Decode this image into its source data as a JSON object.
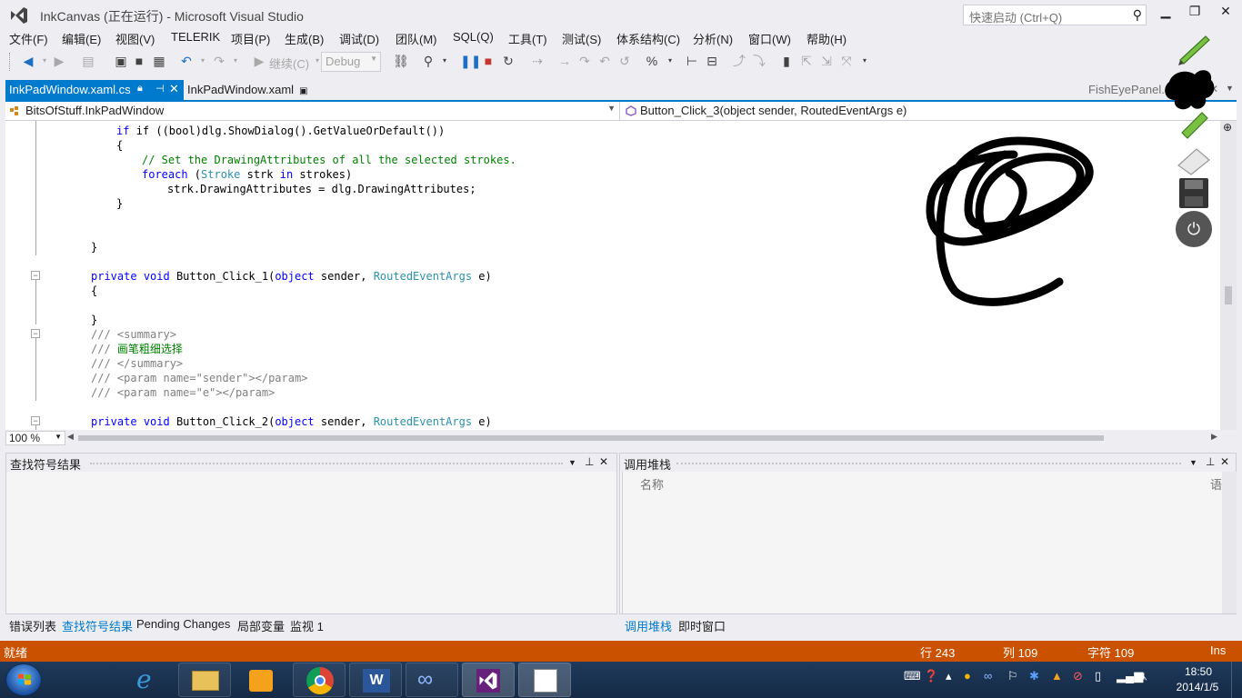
{
  "window": {
    "title": "InkCanvas (正在运行) - Microsoft Visual Studio",
    "quick_launch_placeholder": "快速启动 (Ctrl+Q)",
    "minimize": "▁",
    "restore": "❐",
    "close": "✕"
  },
  "menu": [
    "文件(F)",
    "编辑(E)",
    "视图(V)",
    "TELERIK",
    "项目(P)",
    "生成(B)",
    "调试(D)",
    "团队(M)",
    "SQL(Q)",
    "工具(T)",
    "测试(S)",
    "体系结构(C)",
    "分析(N)",
    "窗口(W)",
    "帮助(H)"
  ],
  "toolbar": {
    "continue_label": "继续(C)",
    "config_label": "Debug"
  },
  "tabs": {
    "active": "InkPadWindow.xaml.cs",
    "second": "InkPadWindow.xaml",
    "right": "FishEyePanel.cs"
  },
  "navbar": {
    "class_name": "BitsOfStuff.InkPadWindow",
    "member_name": "Button_Click_3(object sender, RoutedEventArgs e)"
  },
  "code": {
    "l1": "if ((bool)dlg.ShowDialog().GetValueOrDefault())",
    "l2": "{",
    "l3": "// Set the DrawingAttributes of all the selected strokes.",
    "l4a": "foreach",
    "l4b": " (",
    "l4c": "Stroke",
    "l4d": " strk ",
    "l4e": "in",
    "l4f": " strokes)",
    "l5": "strk.DrawingAttributes = dlg.DrawingAttributes;",
    "l6": "}",
    "l7": "}",
    "l8a": "private",
    "l8b": "void",
    "l8c": " Button_Click_1(",
    "l8d": "object",
    "l8e": " sender, ",
    "l8f": "RoutedEventArgs",
    "l8g": " e)",
    "l9": "{",
    "l10": "}",
    "l11a": "///",
    "l11b": " <summary>",
    "l12a": "///",
    "l12b": " 画笔粗细选择",
    "l13a": "///",
    "l13b": " </summary>",
    "l14a": "///",
    "l14b": " <param name=\"sender\"></param>",
    "l15a": "///",
    "l15b": " <param name=\"e\"></param>",
    "l16c": " Button_Click_2(",
    "zoom": "100 %"
  },
  "panes": {
    "left_title": "查找符号结果",
    "right_title": "调用堆栈",
    "callstack_col_name": "名称",
    "callstack_col_lang": "语言",
    "left_tabs": [
      "错误列表",
      "查找符号结果",
      "Pending Changes",
      "局部变量",
      "监视 1"
    ],
    "right_tabs": [
      "调用堆栈",
      "即时窗口"
    ]
  },
  "status": {
    "ready": "就绪",
    "line": "行 243",
    "col": "列 109",
    "char": "字符 109",
    "mode": "Ins"
  },
  "taskbar": {
    "time": "18:50",
    "date": "2014/1/5"
  },
  "colors": {
    "accent": "#007acc",
    "statusbar": "#ca5100",
    "keyword": "#0000ff",
    "type": "#2b91af",
    "comment": "#008000"
  }
}
